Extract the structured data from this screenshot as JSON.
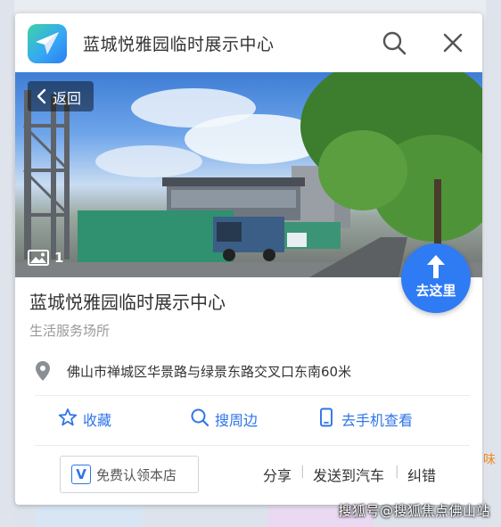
{
  "header": {
    "title": "蓝城悦雅园临时展示中心",
    "logo_icon": "paper-plane-icon",
    "search_icon": "search-icon",
    "close_icon": "close-icon"
  },
  "photo": {
    "back_label": "返回",
    "photo_count": "1"
  },
  "go_button": {
    "label": "去这里"
  },
  "poi": {
    "name": "蓝城悦雅园临时展示中心",
    "category": "生活服务场所",
    "address": "佛山市禅城区华景路与绿景东路交叉口东南60米"
  },
  "actions": [
    {
      "label": "收藏",
      "icon": "star-icon"
    },
    {
      "label": "搜周边",
      "icon": "search-icon"
    },
    {
      "label": "去手机查看",
      "icon": "phone-icon"
    }
  ],
  "footer": {
    "claim_icon_letter": "V",
    "claim_label": "免费认领本店",
    "share": "分享",
    "send_to_car": "发送到汽车",
    "report_error": "纠错"
  },
  "map": {
    "poi_label_fragment": "味"
  },
  "watermark": "搜狐号@搜狐焦点佛山站",
  "colors": {
    "accent": "#2f75e8",
    "go_button": "#2f7bf4",
    "text_primary": "#333333",
    "text_secondary": "#999999"
  }
}
